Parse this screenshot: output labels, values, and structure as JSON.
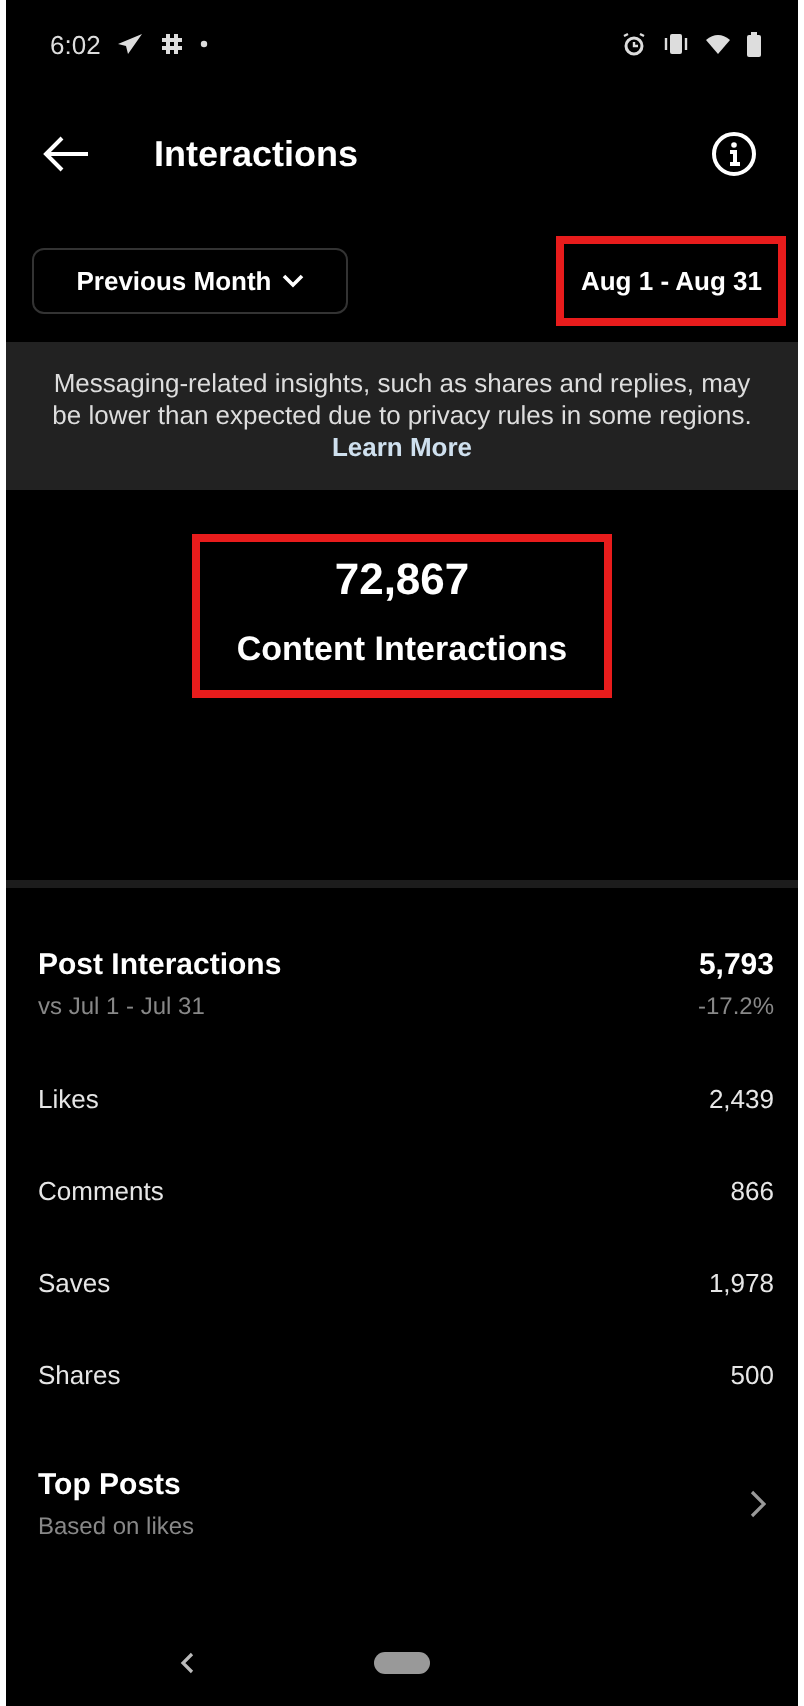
{
  "status_bar": {
    "time": "6:02"
  },
  "header": {
    "title": "Interactions"
  },
  "filter": {
    "period": "Previous Month",
    "date_range": {
      "text": "Aug 1 - Aug 31",
      "highlighted": true
    }
  },
  "notice": {
    "text": "Messaging-related insights, such as shares and replies, may be lower than expected due to privacy rules in some regions.",
    "link": "Learn More"
  },
  "summary": {
    "value": "72,867",
    "label": "Content Interactions",
    "highlighted": true
  },
  "post_interactions": {
    "title": "Post Interactions",
    "comparison": "vs Jul 1 - Jul 31",
    "value": "5,793",
    "change": "-17.2%"
  },
  "metrics": [
    {
      "label": "Likes",
      "value": "2,439"
    },
    {
      "label": "Comments",
      "value": "866"
    },
    {
      "label": "Saves",
      "value": "1,978"
    },
    {
      "label": "Shares",
      "value": "500"
    }
  ],
  "top_posts": {
    "title": "Top Posts",
    "subtitle": "Based on likes"
  }
}
